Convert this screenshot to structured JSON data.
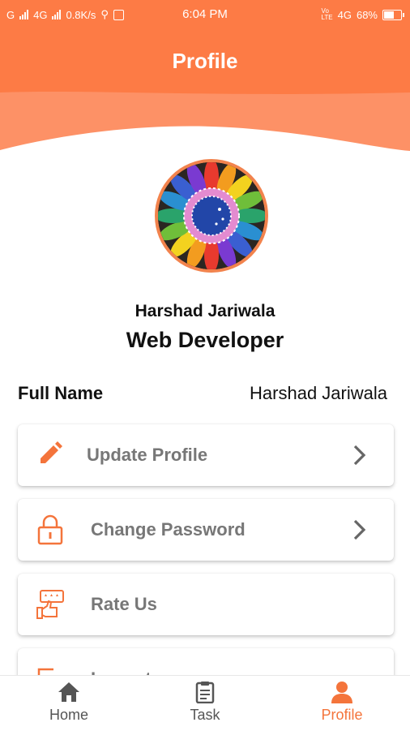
{
  "status_bar": {
    "network_left": "G",
    "network_4g": "4G",
    "speed": "0.8K/s",
    "time": "6:04 PM",
    "network_right": "4G",
    "battery": "68%",
    "battery_level": 0.68
  },
  "header": {
    "title": "Profile"
  },
  "colors": {
    "accent": "#fd7b45",
    "accent_light": "#fda57f",
    "nav_active": "#f4743b"
  },
  "profile": {
    "name": "Harshad Jariwala",
    "role": "Web Developer",
    "full_name_label": "Full Name",
    "full_name_value": "Harshad Jariwala"
  },
  "menu": [
    {
      "label": "Update Profile",
      "icon": "pencil-icon",
      "chevron": true
    },
    {
      "label": "Change Password",
      "icon": "lock-icon",
      "chevron": true
    },
    {
      "label": "Rate Us",
      "icon": "rate-us-icon",
      "chevron": false
    },
    {
      "label": "Logout",
      "icon": "logout-icon",
      "chevron": false
    }
  ],
  "bottom_nav": [
    {
      "label": "Home",
      "icon": "home-icon",
      "active": false
    },
    {
      "label": "Task",
      "icon": "clipboard-icon",
      "active": false
    },
    {
      "label": "Profile",
      "icon": "person-icon",
      "active": true
    }
  ]
}
